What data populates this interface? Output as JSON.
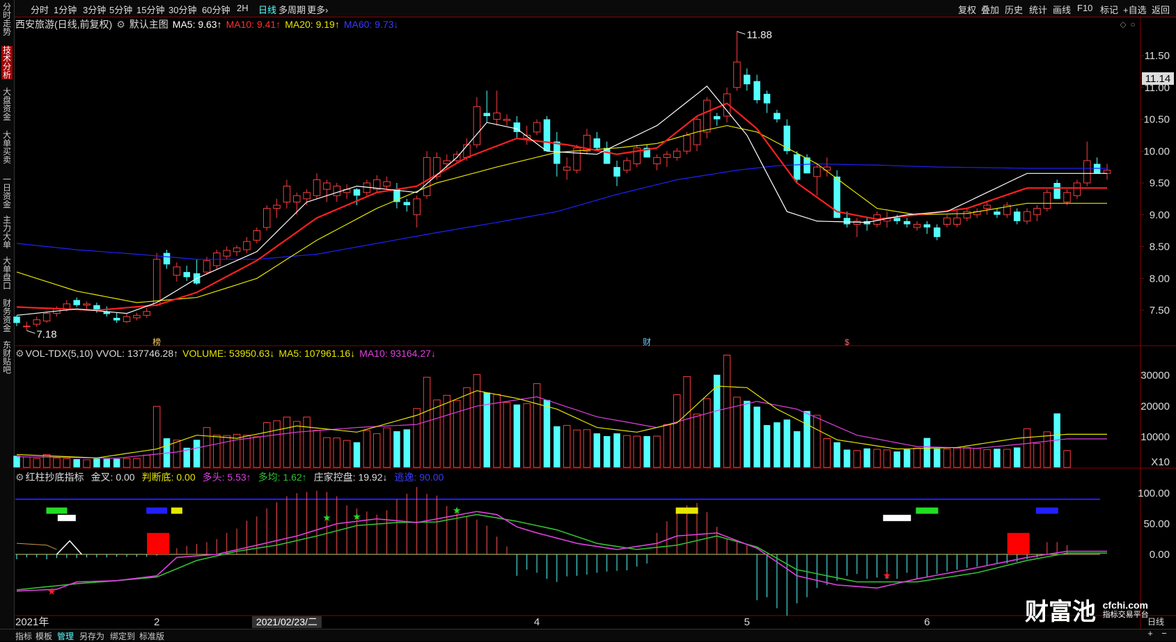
{
  "toolbar": {
    "left": [
      "分时",
      "1分钟",
      "3分钟",
      "5分钟",
      "15分钟",
      "30分钟",
      "60分钟",
      "2H",
      "日线",
      "多周期",
      "更多›"
    ],
    "active_index": 8,
    "right": [
      "复权",
      "叠加",
      "历史",
      "统计",
      "画线",
      "F10",
      "标记",
      "+自选",
      "返回"
    ]
  },
  "side_tabs": [
    "分时走势",
    "技术分析",
    "大盘资金",
    "大单买卖",
    "一日资金",
    "主力大单",
    "大单盘口",
    "财务资金",
    "东财贴吧"
  ],
  "side_active": 1,
  "bottom_tabs": [
    "指标",
    "模板",
    "管理",
    "另存为",
    "绑定到",
    "标准版"
  ],
  "bottom_active": 2,
  "price_panel": {
    "stock": "西安旅游(日线,前复权)",
    "template": "默认主图",
    "ma5": "MA5: 9.63↑",
    "ma10": "MA10: 9.41↑",
    "ma20": "MA20: 9.19↑",
    "ma60": "MA60: 9.73↓",
    "high_label": "11.88",
    "low_label": "7.18",
    "current_price": "11.14"
  },
  "vol_panel": {
    "name": "VOL-TDX(5,10)",
    "vvol": "VVOL: 137746.28↑",
    "volume": "VOLUME: 53950.63↓",
    "ma5": "MA5: 107961.16↓",
    "ma10": "MA10: 93164.27↓",
    "unit": "X10"
  },
  "ind_panel": {
    "name": "红柱抄底指标",
    "jincha": "金叉: 0.00",
    "panduandi": "判断底: 0.00",
    "duotou": "多头: 5.53↑",
    "duojun": "多均: 1.62↑",
    "zhuangjia": "庄家控盘: 19.92↓",
    "taoyi": "逃逸: 90.00"
  },
  "markers": {
    "m1": "榜",
    "m2": "财",
    "m3": "$"
  },
  "date_labels": [
    {
      "i": 0,
      "text": "2021年"
    },
    {
      "i": 14,
      "text": "2"
    },
    {
      "i": 52,
      "text": "4"
    },
    {
      "i": 73,
      "text": "5"
    },
    {
      "i": 91,
      "text": "6"
    }
  ],
  "crosshair_date": "2021/02/23/二",
  "crosshair_i": 27,
  "logo": {
    "text": "财富池",
    "site": "cfchi.com",
    "sub": "指标交易平台"
  },
  "colors": {
    "up": "#ff3c3c",
    "down": "#54ffff",
    "ma5": "#ffffff",
    "ma10": "#ff2020",
    "ma20": "#e6e600",
    "ma60": "#2020ff",
    "vma5": "#e6e600",
    "vma10": "#e040e0",
    "duotou": "#e040e0",
    "duojun": "#30c030"
  },
  "chart_data": {
    "type": "candlestick",
    "price_axis": {
      "ylim": [
        7.0,
        12.0
      ],
      "ticks": [
        7.5,
        8.0,
        8.5,
        9.0,
        9.5,
        10.0,
        10.5,
        11.0,
        11.5
      ]
    },
    "candles": [
      [
        7.4,
        7.42,
        7.25,
        7.3
      ],
      [
        7.25,
        7.32,
        7.18,
        7.25
      ],
      [
        7.28,
        7.4,
        7.24,
        7.35
      ],
      [
        7.33,
        7.48,
        7.3,
        7.45
      ],
      [
        7.45,
        7.56,
        7.4,
        7.52
      ],
      [
        7.52,
        7.66,
        7.48,
        7.6
      ],
      [
        7.66,
        7.7,
        7.55,
        7.58
      ],
      [
        7.58,
        7.64,
        7.52,
        7.6
      ],
      [
        7.58,
        7.62,
        7.46,
        7.5
      ],
      [
        7.48,
        7.56,
        7.4,
        7.44
      ],
      [
        7.38,
        7.46,
        7.3,
        7.34
      ],
      [
        7.32,
        7.44,
        7.3,
        7.4
      ],
      [
        7.38,
        7.46,
        7.34,
        7.42
      ],
      [
        7.42,
        7.54,
        7.38,
        7.48
      ],
      [
        7.58,
        8.4,
        7.56,
        8.3
      ],
      [
        8.4,
        8.45,
        8.15,
        8.22
      ],
      [
        8.05,
        8.25,
        7.95,
        8.18
      ],
      [
        8.1,
        8.2,
        7.96,
        8.02
      ],
      [
        8.08,
        8.3,
        7.9,
        7.92
      ],
      [
        8.1,
        8.34,
        8.06,
        8.28
      ],
      [
        8.2,
        8.45,
        8.15,
        8.4
      ],
      [
        8.35,
        8.5,
        8.3,
        8.44
      ],
      [
        8.42,
        8.52,
        8.35,
        8.48
      ],
      [
        8.45,
        8.65,
        8.4,
        8.58
      ],
      [
        8.6,
        8.8,
        8.55,
        8.75
      ],
      [
        8.8,
        9.15,
        8.75,
        9.1
      ],
      [
        9.1,
        9.25,
        8.95,
        9.15
      ],
      [
        9.2,
        9.55,
        9.1,
        9.45
      ],
      [
        9.2,
        9.35,
        9.0,
        9.3
      ],
      [
        9.25,
        9.4,
        9.15,
        9.35
      ],
      [
        9.3,
        9.65,
        9.25,
        9.55
      ],
      [
        9.4,
        9.55,
        9.2,
        9.5
      ],
      [
        9.3,
        9.5,
        9.2,
        9.45
      ],
      [
        9.35,
        9.48,
        9.25,
        9.4
      ],
      [
        9.4,
        9.42,
        9.15,
        9.3
      ],
      [
        9.35,
        9.55,
        9.3,
        9.5
      ],
      [
        9.4,
        9.62,
        9.35,
        9.55
      ],
      [
        9.45,
        9.6,
        9.4,
        9.52
      ],
      [
        9.4,
        9.5,
        9.1,
        9.2
      ],
      [
        9.2,
        9.25,
        9.05,
        9.15
      ],
      [
        9.0,
        9.3,
        8.8,
        9.25
      ],
      [
        9.3,
        10.0,
        9.25,
        9.9
      ],
      [
        9.6,
        9.98,
        9.55,
        9.9
      ],
      [
        9.8,
        9.95,
        9.7,
        9.85
      ],
      [
        9.85,
        10.0,
        9.8,
        9.95
      ],
      [
        9.9,
        10.2,
        9.85,
        10.1
      ],
      [
        10.1,
        10.85,
        10.05,
        10.7
      ],
      [
        10.6,
        10.95,
        10.45,
        10.55
      ],
      [
        10.5,
        10.95,
        10.4,
        10.6
      ],
      [
        10.48,
        10.58,
        10.4,
        10.5
      ],
      [
        10.45,
        10.55,
        10.2,
        10.3
      ],
      [
        10.2,
        10.4,
        10.1,
        10.25
      ],
      [
        10.3,
        10.5,
        10.25,
        10.45
      ],
      [
        10.5,
        10.55,
        10.0,
        10.0
      ],
      [
        10.15,
        10.3,
        9.6,
        9.8
      ],
      [
        9.7,
        9.9,
        9.55,
        9.75
      ],
      [
        9.7,
        10.1,
        9.65,
        10.05
      ],
      [
        10.0,
        10.35,
        9.95,
        10.25
      ],
      [
        10.2,
        10.3,
        10.0,
        10.05
      ],
      [
        10.05,
        10.15,
        9.8,
        9.8
      ],
      [
        9.75,
        9.85,
        9.45,
        9.6
      ],
      [
        9.7,
        9.9,
        9.65,
        9.85
      ],
      [
        9.8,
        10.1,
        9.75,
        10.05
      ],
      [
        10.05,
        10.1,
        9.9,
        9.9
      ],
      [
        9.8,
        9.95,
        9.7,
        9.9
      ],
      [
        9.9,
        10.0,
        9.75,
        9.95
      ],
      [
        9.9,
        10.05,
        9.85,
        10.0
      ],
      [
        10.0,
        10.3,
        9.95,
        10.25
      ],
      [
        10.1,
        10.55,
        10.0,
        10.5
      ],
      [
        10.3,
        10.85,
        10.2,
        10.8
      ],
      [
        10.55,
        10.6,
        10.4,
        10.5
      ],
      [
        10.55,
        11.0,
        10.45,
        10.9
      ],
      [
        11.0,
        11.88,
        10.95,
        11.4
      ],
      [
        11.2,
        11.3,
        10.95,
        11.05
      ],
      [
        11.1,
        11.2,
        10.75,
        10.8
      ],
      [
        10.9,
        10.95,
        10.6,
        10.75
      ],
      [
        10.6,
        10.65,
        10.45,
        10.5
      ],
      [
        10.4,
        10.5,
        9.95,
        10.0
      ],
      [
        9.95,
        10.0,
        9.5,
        9.55
      ],
      [
        9.9,
        9.95,
        9.65,
        9.65
      ],
      [
        9.6,
        9.8,
        9.3,
        9.75
      ],
      [
        9.7,
        9.9,
        9.6,
        9.75
      ],
      [
        9.6,
        9.7,
        8.95,
        8.95
      ],
      [
        8.95,
        9.05,
        8.8,
        8.85
      ],
      [
        8.85,
        8.95,
        8.65,
        8.9
      ],
      [
        8.9,
        8.95,
        8.75,
        8.85
      ],
      [
        8.85,
        9.05,
        8.8,
        9.0
      ],
      [
        8.9,
        9.05,
        8.8,
        8.95
      ],
      [
        8.95,
        9.0,
        8.85,
        8.9
      ],
      [
        8.9,
        8.95,
        8.8,
        8.85
      ],
      [
        8.8,
        8.9,
        8.75,
        8.85
      ],
      [
        8.85,
        8.9,
        8.7,
        8.8
      ],
      [
        8.8,
        8.85,
        8.6,
        8.65
      ],
      [
        8.85,
        9.0,
        8.8,
        8.95
      ],
      [
        8.85,
        9.1,
        8.8,
        8.95
      ],
      [
        8.95,
        9.1,
        8.9,
        9.05
      ],
      [
        9.0,
        9.1,
        8.95,
        9.05
      ],
      [
        9.1,
        9.2,
        9.0,
        9.15
      ],
      [
        9.05,
        9.1,
        8.95,
        9.0
      ],
      [
        9.0,
        9.2,
        8.95,
        9.15
      ],
      [
        9.05,
        9.1,
        8.85,
        8.9
      ],
      [
        8.9,
        9.1,
        8.85,
        9.05
      ],
      [
        9.0,
        9.15,
        8.9,
        9.1
      ],
      [
        9.1,
        9.4,
        9.05,
        9.35
      ],
      [
        9.5,
        9.55,
        9.25,
        9.25
      ],
      [
        9.2,
        9.4,
        9.15,
        9.35
      ],
      [
        9.3,
        9.55,
        9.25,
        9.5
      ],
      [
        9.5,
        10.15,
        9.45,
        9.85
      ],
      [
        9.8,
        9.9,
        9.65,
        9.65
      ],
      [
        9.65,
        9.8,
        9.55,
        9.7
      ]
    ],
    "ma_series": {
      "ma5": {
        "i": [
          0,
          6,
          11,
          14,
          18,
          24,
          29,
          34,
          40,
          44,
          47,
          50,
          53,
          58,
          64,
          69,
          73,
          77,
          80,
          85,
          89,
          93,
          97,
          101
        ],
        "v": [
          7.42,
          7.52,
          7.45,
          7.62,
          8.0,
          8.42,
          9.2,
          9.45,
          9.35,
          9.9,
          10.45,
          10.35,
          10.0,
          9.95,
          10.4,
          11.02,
          10.25,
          9.05,
          8.9,
          8.88,
          9.0,
          9.05,
          9.35,
          9.65
        ]
      },
      "ma10": {
        "i": [
          0,
          8,
          14,
          18,
          24,
          30,
          36,
          40,
          45,
          50,
          55,
          60,
          64,
          68,
          71,
          74,
          78,
          82,
          86,
          90,
          95,
          101
        ],
        "v": [
          7.55,
          7.5,
          7.58,
          7.78,
          8.28,
          8.95,
          9.35,
          9.45,
          9.9,
          10.2,
          10.1,
          9.95,
          10.05,
          10.55,
          10.75,
          10.35,
          9.5,
          9.05,
          8.93,
          9.0,
          9.1,
          9.42
        ]
      },
      "ma20": {
        "i": [
          0,
          6,
          12,
          18,
          24,
          30,
          36,
          42,
          48,
          54,
          60,
          64,
          68,
          71,
          74,
          80,
          86,
          90,
          95,
          101
        ],
        "v": [
          8.1,
          7.8,
          7.62,
          7.7,
          8.0,
          8.6,
          9.1,
          9.5,
          9.75,
          9.98,
          10.05,
          10.12,
          10.3,
          10.4,
          10.3,
          9.8,
          9.1,
          9.0,
          9.02,
          9.18
        ]
      },
      "ma60": {
        "i": [
          0,
          6,
          12,
          18,
          24,
          30,
          36,
          42,
          48,
          54,
          60,
          66,
          72,
          76,
          80,
          86,
          92,
          101
        ],
        "v": [
          8.55,
          8.45,
          8.38,
          8.3,
          8.3,
          8.38,
          8.55,
          8.72,
          8.88,
          9.05,
          9.32,
          9.55,
          9.7,
          9.77,
          9.8,
          9.78,
          9.75,
          9.73
        ]
      }
    },
    "volume_axis": {
      "ylim": [
        0,
        37000
      ],
      "ticks": [
        10000,
        20000,
        30000
      ]
    },
    "volume": [
      3800,
      3400,
      2900,
      4200,
      3100,
      2900,
      2700,
      2500,
      2900,
      2800,
      2800,
      2900,
      2900,
      4000,
      19900,
      9500,
      8900,
      6400,
      9000,
      13000,
      10500,
      10400,
      10800,
      10500,
      10000,
      14600,
      15200,
      16400,
      15000,
      16400,
      12100,
      9700,
      9600,
      8800,
      8200,
      12000,
      11000,
      12900,
      11800,
      12400,
      19200,
      29400,
      22000,
      23500,
      21800,
      26000,
      30300,
      24400,
      23800,
      21200,
      20500,
      20800,
      27300,
      22000,
      13400,
      13700,
      12200,
      12300,
      11100,
      10200,
      11100,
      10400,
      10200,
      10200,
      10200,
      14000,
      23700,
      29600,
      17400,
      22400,
      30200,
      36600,
      22900,
      21700,
      19800,
      13800,
      14700,
      15600,
      11800,
      18400,
      17000,
      9400,
      8200,
      5800,
      5500,
      6200,
      5900,
      5700,
      5200,
      5900,
      6300,
      9600,
      6100,
      6000,
      6300,
      6500,
      6200,
      5800,
      6100,
      5900,
      6500,
      12600,
      7800,
      11600,
      17600,
      5500
    ],
    "vol_ma5": {
      "i": [
        0,
        8,
        14,
        18,
        22,
        28,
        34,
        40,
        46,
        50,
        54,
        58,
        62,
        66,
        70,
        73,
        76,
        82,
        88,
        94,
        100,
        105
      ],
      "v": [
        4200,
        3100,
        6000,
        10500,
        9500,
        13500,
        11500,
        17000,
        25000,
        22500,
        19000,
        13000,
        11500,
        14500,
        26500,
        26000,
        19000,
        9000,
        6000,
        6500,
        9500,
        10800
      ]
    },
    "vol_ma10": {
      "i": [
        0,
        10,
        16,
        22,
        28,
        34,
        40,
        46,
        52,
        58,
        64,
        70,
        74,
        78,
        84,
        90,
        96,
        101,
        105
      ],
      "v": [
        3500,
        3000,
        5000,
        9000,
        11500,
        13000,
        14000,
        20000,
        23000,
        16500,
        13000,
        18500,
        21500,
        19000,
        10500,
        6800,
        6200,
        7800,
        9300
      ]
    },
    "ind_axis": {
      "ylim": [
        -90,
        115
      ],
      "ticks": [
        0,
        50,
        100
      ]
    },
    "ind_bars": [
      -8,
      -5,
      -5,
      -8,
      -6,
      -6,
      -6,
      -5,
      -5,
      -5,
      -4,
      -4,
      -4,
      -4,
      -2,
      5,
      10,
      14,
      17,
      20,
      25,
      35,
      42,
      55,
      62,
      75,
      85,
      95,
      100,
      102,
      104,
      102,
      95,
      80,
      75,
      70,
      65,
      72,
      90,
      99,
      110,
      99,
      96,
      79,
      72,
      63,
      57,
      47,
      29,
      13,
      -35,
      -25,
      -30,
      -40,
      -45,
      -36,
      -35,
      -33,
      -30,
      -28,
      -27,
      -26,
      -20,
      -15,
      35,
      54,
      69,
      80,
      84,
      69,
      45,
      25,
      20,
      15,
      -75,
      -70,
      -88,
      -100,
      -80,
      -70,
      -55,
      -50,
      -43,
      -35,
      -32,
      -40,
      -38,
      -40,
      -40,
      -30,
      -40,
      -38,
      -32,
      -28,
      -25,
      -22,
      -20,
      -18,
      -16,
      -15,
      -12,
      -8,
      -5,
      20,
      20,
      15
    ],
    "duotou": {
      "i": [
        0,
        4,
        6,
        10,
        14,
        16,
        20,
        24,
        28,
        32,
        36,
        38,
        40,
        42,
        46,
        48,
        50,
        52,
        56,
        60,
        64,
        66,
        70,
        74,
        78,
        82,
        86,
        90,
        95,
        101,
        105
      ],
      "v": [
        -60,
        -57,
        -45,
        -43,
        -35,
        -5,
        0,
        15,
        30,
        50,
        58,
        55,
        52,
        58,
        70,
        65,
        45,
        35,
        18,
        8,
        18,
        30,
        35,
        10,
        -35,
        -50,
        -55,
        -40,
        -25,
        -5,
        5
      ]
    },
    "duojun": {
      "i": [
        0,
        6,
        10,
        14,
        18,
        22,
        26,
        30,
        34,
        38,
        42,
        46,
        50,
        54,
        58,
        62,
        66,
        70,
        74,
        78,
        84,
        90,
        96,
        101,
        105
      ],
      "v": [
        -58,
        -48,
        -43,
        -37,
        -10,
        5,
        15,
        30,
        47,
        52,
        53,
        65,
        54,
        40,
        18,
        8,
        15,
        30,
        12,
        -25,
        -45,
        -45,
        -30,
        -10,
        2
      ]
    },
    "taoyi_level": 90,
    "jincha_level": 0
  }
}
